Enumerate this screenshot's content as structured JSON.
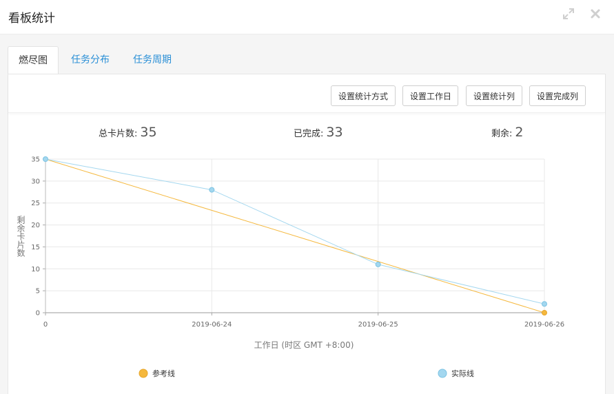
{
  "window": {
    "title": "看板统计"
  },
  "tabs": [
    {
      "label": "燃尽图",
      "active": true
    },
    {
      "label": "任务分布",
      "active": false
    },
    {
      "label": "任务周期",
      "active": false
    }
  ],
  "toolbar": {
    "buttons": [
      "设置统计方式",
      "设置工作日",
      "设置统计列",
      "设置完成列"
    ]
  },
  "stats": {
    "total_label": "总卡片数:",
    "total": "35",
    "done_label": "已完成:",
    "done": "33",
    "remaining_label": "剩余:",
    "remaining": "2"
  },
  "colors": {
    "accent": "#2a8fd6",
    "reference": "#f5b83d",
    "actual": "#a3d7ef"
  },
  "chart_data": {
    "type": "line",
    "categories": [
      "0",
      "2019-06-24",
      "2019-06-25",
      "2019-06-26"
    ],
    "series": [
      {
        "name": "参考线",
        "values": [
          35,
          23.33,
          11.67,
          0
        ],
        "color": "#f5b83d"
      },
      {
        "name": "实际线",
        "values": [
          35,
          28,
          11,
          2
        ],
        "color": "#a3d7ef"
      }
    ],
    "xlabel": "工作日 (时区 GMT +8:00)",
    "ylabel": "剩余卡片数",
    "ylim": [
      0,
      35
    ],
    "yticks": [
      0,
      5,
      10,
      15,
      20,
      25,
      30,
      35
    ],
    "grid": true,
    "legend_position": "bottom"
  }
}
